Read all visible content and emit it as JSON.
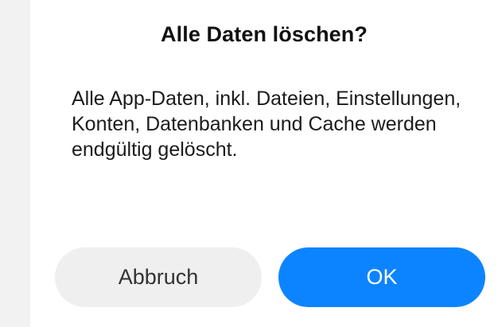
{
  "dialog": {
    "title": "Alle Daten löschen?",
    "message": "Alle App-Daten, inkl. Dateien, Einstellungen, Konten, Datenbanken und Cache werden endgültig gelöscht.",
    "buttons": {
      "cancel_label": "Abbruch",
      "ok_label": "OK"
    }
  },
  "colors": {
    "accent": "#0d84ff",
    "cancel_bg": "#efefef",
    "background": "#f2f2f2"
  }
}
